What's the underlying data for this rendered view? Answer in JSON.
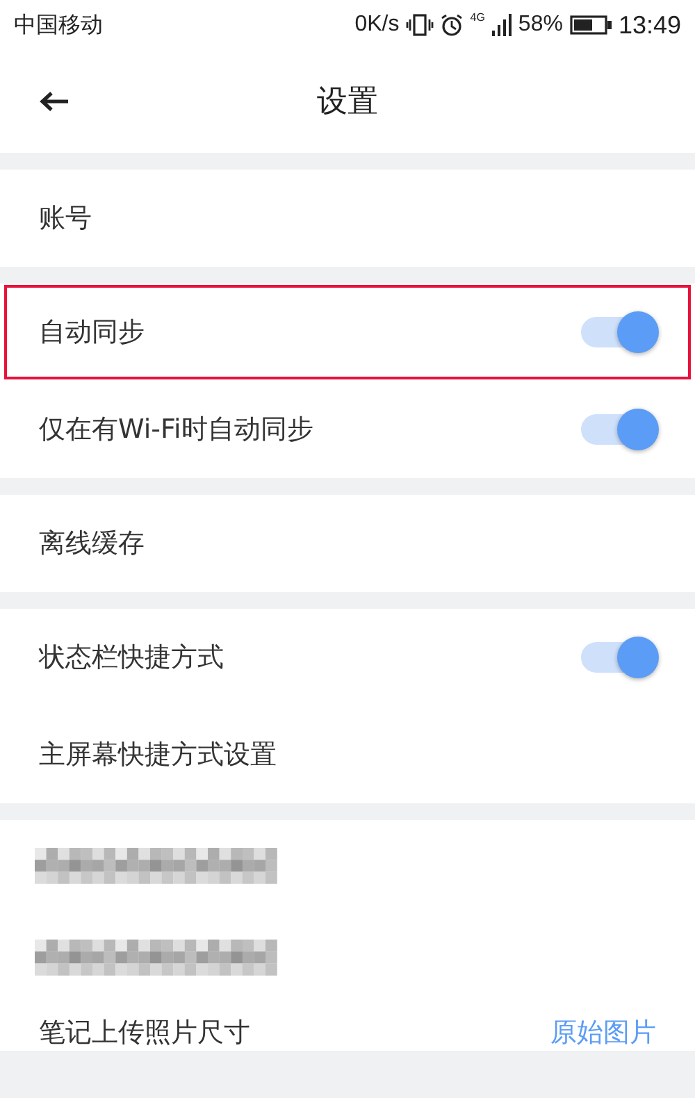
{
  "status_bar": {
    "carrier": "中国移动",
    "speed": "0K/s",
    "network": "4G",
    "battery": "58%",
    "time": "13:49"
  },
  "header": {
    "title": "设置"
  },
  "sections": [
    {
      "items": [
        {
          "kind": "link",
          "label": "账号"
        }
      ]
    },
    {
      "items": [
        {
          "kind": "toggle",
          "label": "自动同步",
          "on": true,
          "highlighted": true
        },
        {
          "kind": "toggle",
          "label": "仅在有Wi-Fi时自动同步",
          "on": true,
          "highlighted": false
        }
      ]
    },
    {
      "items": [
        {
          "kind": "link",
          "label": "离线缓存"
        }
      ]
    },
    {
      "items": [
        {
          "kind": "toggle",
          "label": "状态栏快捷方式",
          "on": true,
          "highlighted": false
        },
        {
          "kind": "link",
          "label": "主屏幕快捷方式设置"
        }
      ]
    },
    {
      "items": [
        {
          "kind": "redacted"
        },
        {
          "kind": "redacted"
        },
        {
          "kind": "value",
          "label": "笔记上传照片尺寸",
          "value": "原始图片"
        }
      ]
    }
  ]
}
